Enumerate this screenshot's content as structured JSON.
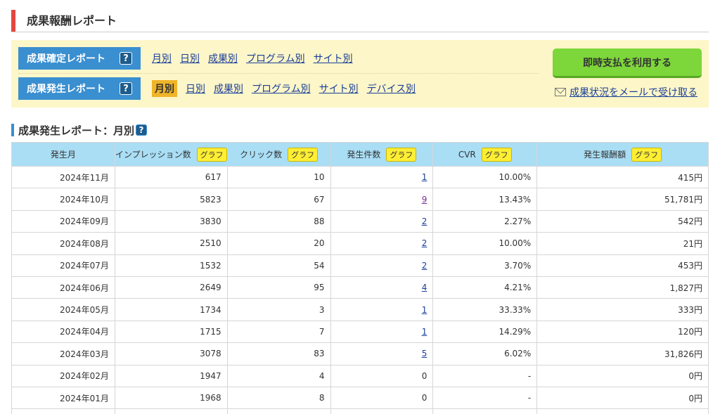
{
  "page": {
    "title": "成果報酬レポート"
  },
  "nav": {
    "confirmed": {
      "label": "成果確定レポート",
      "help": "?",
      "links": [
        "月別",
        "日別",
        "成果別",
        "プログラム別",
        "サイト別"
      ]
    },
    "occurred": {
      "label": "成果発生レポート",
      "help": "?",
      "active": "月別",
      "links": [
        "日別",
        "成果別",
        "プログラム別",
        "サイト別",
        "デバイス別"
      ]
    },
    "pay_button": "即時支払を利用する",
    "mail_link": "成果状況をメールで受け取る"
  },
  "section": {
    "title": "成果発生レポート：月別",
    "help": "?"
  },
  "table": {
    "graph_label": "グラフ",
    "headers": [
      "発生月",
      "インプレッション数",
      "クリック数",
      "発生件数",
      "CVR",
      "発生報酬額"
    ],
    "rows": [
      [
        "2024年11月",
        "617",
        "10",
        "1",
        "10.00%",
        "415円"
      ],
      [
        "2024年10月",
        "5823",
        "67",
        "9",
        "13.43%",
        "51,781円"
      ],
      [
        "2024年09月",
        "3830",
        "88",
        "2",
        "2.27%",
        "542円"
      ],
      [
        "2024年08月",
        "2510",
        "20",
        "2",
        "10.00%",
        "21円"
      ],
      [
        "2024年07月",
        "1532",
        "54",
        "2",
        "3.70%",
        "453円"
      ],
      [
        "2024年06月",
        "2649",
        "95",
        "4",
        "4.21%",
        "1,827円"
      ],
      [
        "2024年05月",
        "1734",
        "3",
        "1",
        "33.33%",
        "333円"
      ],
      [
        "2024年04月",
        "1715",
        "7",
        "1",
        "14.29%",
        "120円"
      ],
      [
        "2024年03月",
        "3078",
        "83",
        "5",
        "6.02%",
        "31,826円"
      ],
      [
        "2024年02月",
        "1947",
        "4",
        "0",
        "-",
        "0円"
      ],
      [
        "2024年01月",
        "1968",
        "8",
        "0",
        "-",
        "0円"
      ]
    ]
  }
}
